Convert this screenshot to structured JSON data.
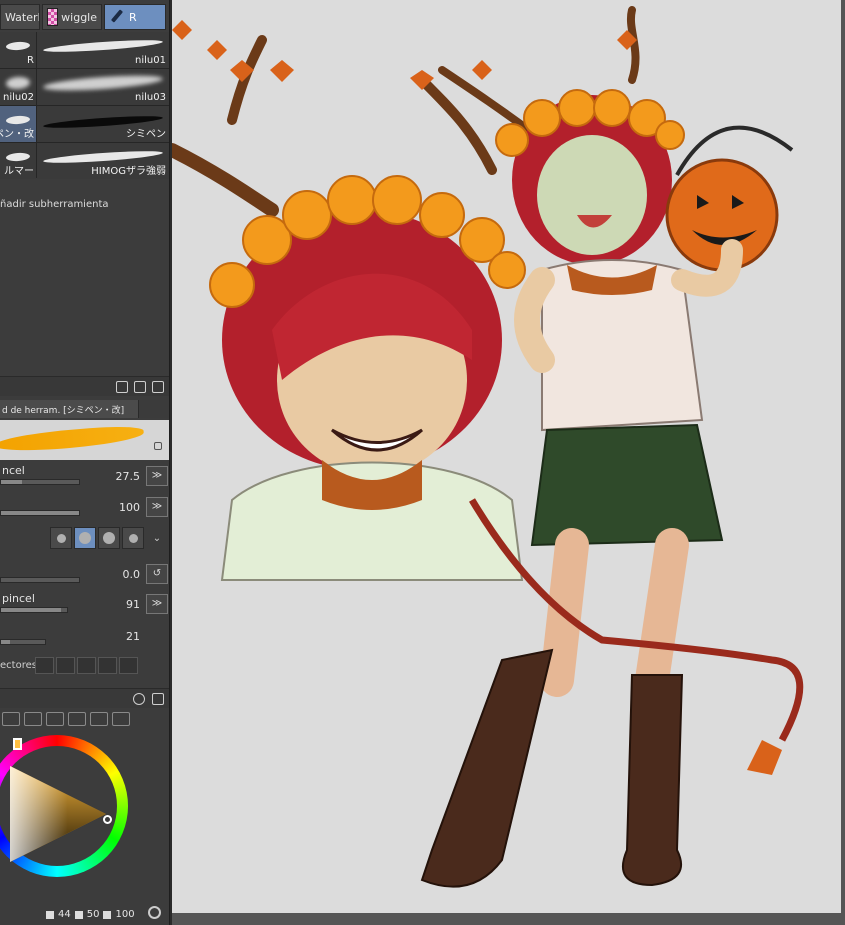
{
  "subtool_tabs": [
    {
      "label": "WaterF",
      "active": false
    },
    {
      "label": "wiggle",
      "active": false
    },
    {
      "label": "R",
      "active": true
    }
  ],
  "brushes": [
    {
      "label": "R"
    },
    {
      "label": "nilu01"
    },
    {
      "label": "nilu02"
    },
    {
      "label": "nilu03"
    },
    {
      "label": "ペン・改"
    },
    {
      "label": "シミペン"
    },
    {
      "label": "ルマー"
    },
    {
      "label": "HIMOGザラ強弱"
    }
  ],
  "add_subtool": "ñadir subherramienta",
  "tool_property": {
    "tab_label": "d de herram. [シミペン・改]",
    "brush_size": {
      "label": "ncel",
      "value": "27.5",
      "fraction": 0.27
    },
    "opacity": {
      "value": "100",
      "fraction": 1.0
    },
    "angle": {
      "value": "0.0"
    },
    "density": {
      "label": "pincel",
      "value": "91",
      "fraction": 0.91
    },
    "stabilization": {
      "value": "21",
      "fraction": 0.21
    },
    "correctors_label": "ectores"
  },
  "color": {
    "accent": "#f4a30a",
    "hsv": [
      "44",
      "50",
      "100"
    ]
  }
}
